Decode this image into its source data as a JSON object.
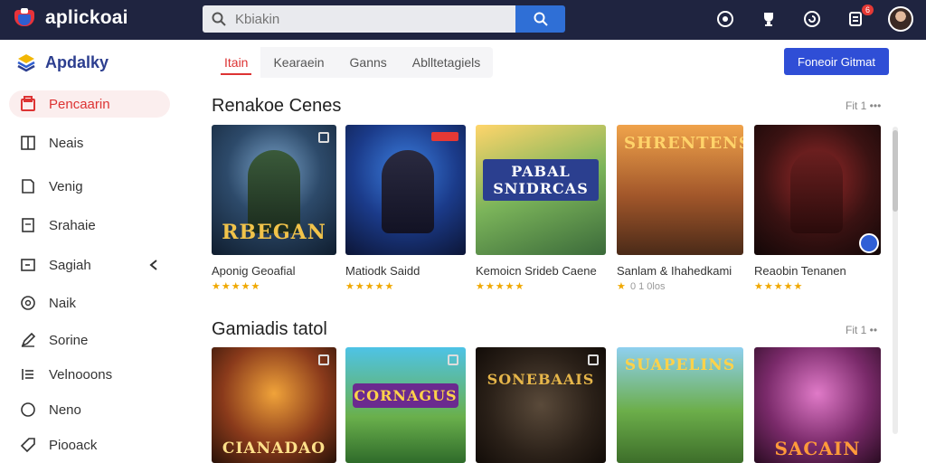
{
  "app": {
    "name": "aplickoai"
  },
  "search": {
    "placeholder": "Kbiakin",
    "value": ""
  },
  "top_icons": {
    "notification_count": "6"
  },
  "sidebar": {
    "brand": "Apdalky",
    "items": [
      {
        "label": "Pencaarin",
        "icon": "store-icon",
        "active": true
      },
      {
        "label": "Neais",
        "icon": "news-icon"
      },
      {
        "label": "Venig",
        "icon": "book-icon"
      },
      {
        "label": "Srahaie",
        "icon": "document-icon"
      },
      {
        "label": "Sagiah",
        "icon": "folder-icon"
      },
      {
        "label": "Naik",
        "icon": "circle-icon"
      },
      {
        "label": "Sorine",
        "icon": "edit-icon"
      },
      {
        "label": "Velnooons",
        "icon": "list-icon"
      },
      {
        "label": "Neno",
        "icon": "chat-icon"
      },
      {
        "label": "Piooack",
        "icon": "tag-icon"
      }
    ]
  },
  "tabs": [
    {
      "label": "Itain",
      "active": true
    },
    {
      "label": "Kearaein"
    },
    {
      "label": "Ganns"
    },
    {
      "label": "Ablltetagiels"
    }
  ],
  "cta": {
    "label": "Foneoir Gitmat"
  },
  "sections": [
    {
      "title": "Renakoe Cenes",
      "more": "Fit 1 •••",
      "cards": [
        {
          "name": "Aponig Geoafial",
          "stars": "★★★★★",
          "rating_text": "",
          "logo": "RBEGAN"
        },
        {
          "name": "Matiodk Saidd",
          "stars": "★★★★★",
          "rating_text": "",
          "logo": ""
        },
        {
          "name": "Kemoicn Srideb Caene",
          "stars": "★★★★★",
          "rating_text": "",
          "logo": "PABAL SNIDRCAS"
        },
        {
          "name": "Sanlam & Ihahedkami",
          "stars": "★",
          "rating_text": "0 1 0los",
          "logo": "SHRENTENS"
        },
        {
          "name": "Reaobin Tenanen",
          "stars": "★★★★★",
          "rating_text": "",
          "logo": ""
        }
      ]
    },
    {
      "title": "Gamiadis tatol",
      "more": "Fit 1 ••",
      "cards": [
        {
          "logo": "CIANADAO"
        },
        {
          "logo": "CORNAGUS"
        },
        {
          "logo": "SONEBAAIS"
        },
        {
          "logo": "SUAPELINS"
        },
        {
          "logo": "SACAIN"
        }
      ]
    }
  ],
  "colors": {
    "topbar": "#1f2440",
    "accent_red": "#d33333",
    "primary_blue": "#2f4ed6",
    "star": "#f0a800"
  }
}
